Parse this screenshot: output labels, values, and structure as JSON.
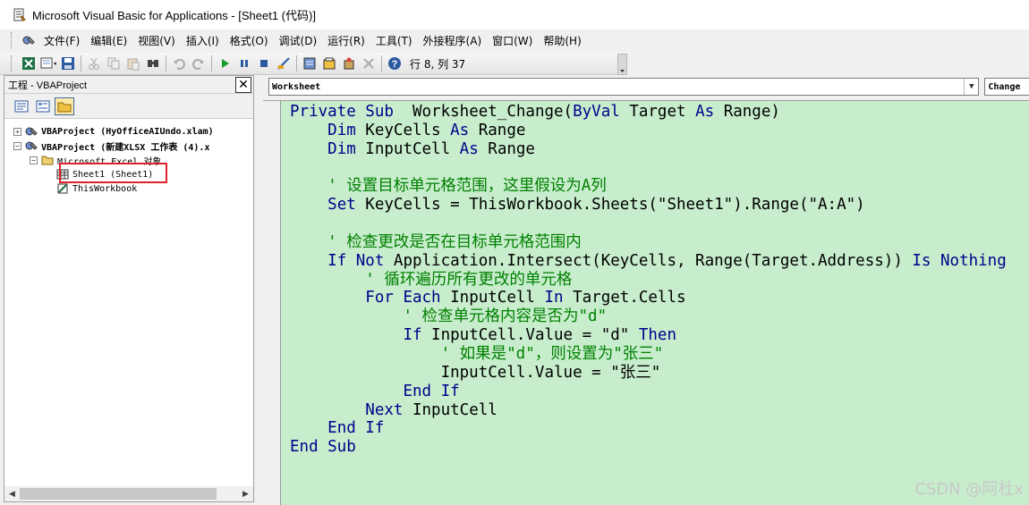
{
  "window": {
    "title": "Microsoft Visual Basic for Applications - [Sheet1 (代码)]"
  },
  "menu": [
    "文件(F)",
    "编辑(E)",
    "视图(V)",
    "插入(I)",
    "格式(O)",
    "调试(D)",
    "运行(R)",
    "工具(T)",
    "外接程序(A)",
    "窗口(W)",
    "帮助(H)"
  ],
  "toolbar": {
    "icons": [
      "excel-icon",
      "insert-module-icon",
      "save-icon",
      "cut-icon",
      "copy-icon",
      "paste-icon",
      "find-icon",
      "undo-icon",
      "redo-icon",
      "run-icon",
      "break-icon",
      "reset-icon",
      "design-mode-icon",
      "project-explorer-icon",
      "properties-icon",
      "object-browser-icon",
      "toolbox-icon",
      "help-icon"
    ],
    "cursor_position": "行 8, 列 37"
  },
  "project_panel": {
    "title": "工程 - VBAProject",
    "close_label": "✕",
    "tree": [
      {
        "label": "VBAProject (HyOfficeAIUndo.xlam)",
        "expander": "+"
      },
      {
        "label": "VBAProject (新建XLSX 工作表 (4).x",
        "expander": "−"
      },
      {
        "label": "Microsoft Excel 对象",
        "expander": "−"
      },
      {
        "label": "Sheet1 (Sheet1)"
      },
      {
        "label": "ThisWorkbook"
      }
    ]
  },
  "code_window": {
    "object_combo": "Worksheet",
    "procedure_combo": "Change",
    "lines": [
      [
        [
          "kw",
          "Private Sub"
        ],
        [
          "",
          "  Worksheet_Change("
        ],
        [
          "kw",
          "ByVal"
        ],
        [
          "",
          " Target "
        ],
        [
          "kw",
          "As"
        ],
        [
          "",
          " Range)"
        ]
      ],
      [
        [
          "",
          "    "
        ],
        [
          "kw",
          "Dim"
        ],
        [
          "",
          " KeyCells "
        ],
        [
          "kw",
          "As"
        ],
        [
          "",
          " Range"
        ]
      ],
      [
        [
          "",
          "    "
        ],
        [
          "kw",
          "Dim"
        ],
        [
          "",
          " InputCell "
        ],
        [
          "kw",
          "As"
        ],
        [
          "",
          " Range"
        ]
      ],
      [
        [
          "",
          ""
        ]
      ],
      [
        [
          "",
          "    "
        ],
        [
          "cm",
          "' 设置目标单元格范围，这里假设为A列"
        ]
      ],
      [
        [
          "",
          "    "
        ],
        [
          "kw",
          "Set"
        ],
        [
          "",
          " KeyCells = ThisWorkbook.Sheets(\"Sheet1\").Range(\"A:A\")"
        ]
      ],
      [
        [
          "",
          ""
        ]
      ],
      [
        [
          "",
          "    "
        ],
        [
          "cm",
          "' 检查更改是否在目标单元格范围内"
        ]
      ],
      [
        [
          "",
          "    "
        ],
        [
          "kw",
          "If Not"
        ],
        [
          "",
          " Application.Intersect(KeyCells, Range(Target.Address)) "
        ],
        [
          "kw",
          "Is Nothing"
        ]
      ],
      [
        [
          "",
          "        "
        ],
        [
          "cm",
          "' 循环遍历所有更改的单元格"
        ]
      ],
      [
        [
          "",
          "        "
        ],
        [
          "kw",
          "For Each"
        ],
        [
          "",
          " InputCell "
        ],
        [
          "kw",
          "In"
        ],
        [
          "",
          " Target.Cells"
        ]
      ],
      [
        [
          "",
          "            "
        ],
        [
          "cm",
          "' 检查单元格内容是否为\"d\""
        ]
      ],
      [
        [
          "",
          "            "
        ],
        [
          "kw",
          "If"
        ],
        [
          "",
          " InputCell.Value = \"d\" "
        ],
        [
          "kw",
          "Then"
        ]
      ],
      [
        [
          "",
          "                "
        ],
        [
          "cm",
          "' 如果是\"d\"，则设置为\"张三\""
        ]
      ],
      [
        [
          "",
          "                InputCell.Value = \"张三\""
        ]
      ],
      [
        [
          "",
          "            "
        ],
        [
          "kw",
          "End If"
        ]
      ],
      [
        [
          "",
          "        "
        ],
        [
          "kw",
          "Next"
        ],
        [
          "",
          " InputCell"
        ]
      ],
      [
        [
          "",
          "    "
        ],
        [
          "kw",
          "End If"
        ]
      ],
      [
        [
          "kw",
          "End Sub"
        ]
      ]
    ]
  },
  "watermark": "CSDN @阿杜x"
}
